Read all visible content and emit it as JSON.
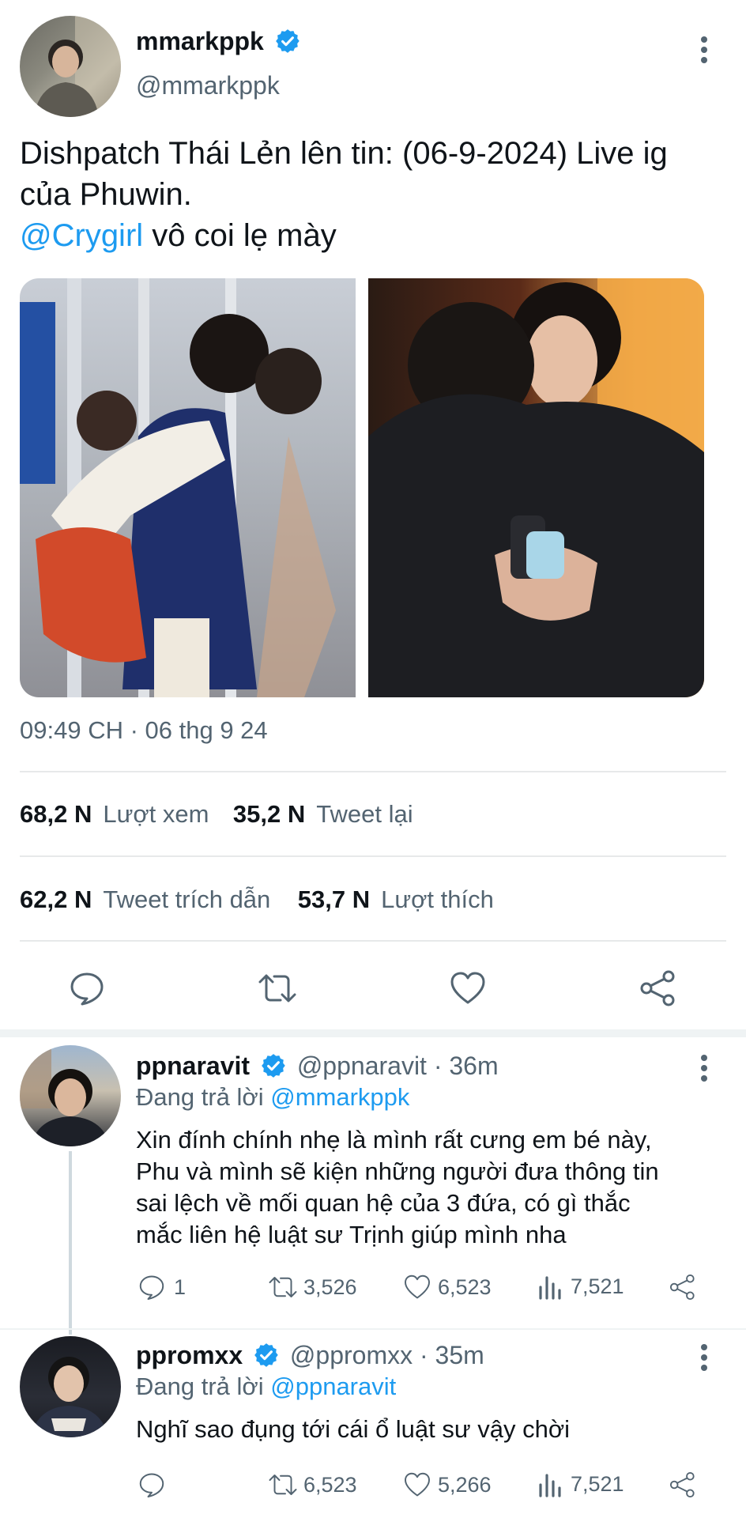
{
  "main_tweet": {
    "display_name": "mmarkppk",
    "handle": "@mmarkppk",
    "text_line1": "Dishpatch Thái Lẻn lên tin: (06-9-2024) Live ig",
    "text_line2": "của Phuwin.",
    "mention": "@Crygirl",
    "text_line3_rest": " vô coi lẹ mày",
    "timestamp": "09:49 CH · 06 thg 9 24",
    "stats": {
      "views_count": "68,2 N",
      "views_label": "Lượt xem",
      "retweets_count": "35,2 N",
      "retweets_label": "Tweet lại",
      "quotes_count": "62,2 N",
      "quotes_label": "Tweet trích dẫn",
      "likes_count": "53,7 N",
      "likes_label": "Lượt thích"
    }
  },
  "replies": [
    {
      "display_name": "ppnaravit",
      "handle": "@ppnaravit",
      "time": "· 36m",
      "replying_label": "Đang trả lời",
      "replying_to": "@mmarkppk",
      "lines": [
        "Xin đính chính nhẹ là mình rất cưng em bé này,",
        "Phu và mình sẽ kiện những người đưa thông tin",
        "sai lệch về mối quan hệ của 3 đứa, có gì thắc",
        "mắc liên hệ luật sư Trịnh giúp mình nha"
      ],
      "reply_count": "1",
      "retweet_count": "3,526",
      "like_count": "6,523",
      "view_count": "7,521"
    },
    {
      "display_name": "ppromxx",
      "handle": "@ppromxx",
      "time": "· 35m",
      "replying_label": "Đang trả lời",
      "replying_to": "@ppnaravit",
      "lines": [
        "Nghĩ sao đụng tới cái ổ luật sư vậy chời"
      ],
      "reply_count": "",
      "retweet_count": "6,523",
      "like_count": "5,266",
      "view_count": "7,521"
    }
  ],
  "colors": {
    "accent": "#1d9bf0",
    "muted": "#536471",
    "divider": "#e7e9ea"
  }
}
